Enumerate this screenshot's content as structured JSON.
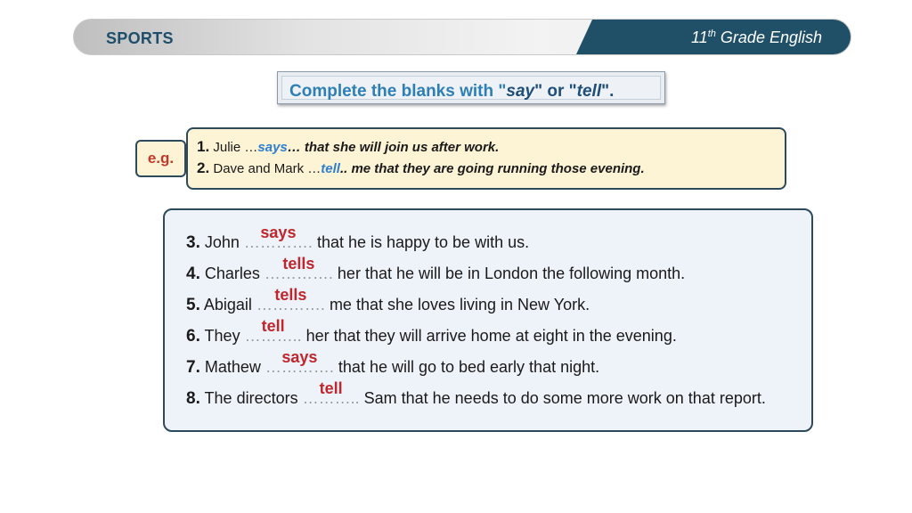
{
  "header": {
    "subject": "SPORTS",
    "grade_prefix": "11",
    "grade_sup": "th",
    "grade_suffix": " Grade English"
  },
  "instruction": {
    "part1": "Complete the blanks with \"",
    "kw1": "say",
    "part2": "\" or \"",
    "kw2": "tell",
    "part3": "\"."
  },
  "example": {
    "label": "e.g.",
    "items": [
      {
        "num": "1.",
        "before": "Julie …",
        "answer": "says",
        "after": "… that she will join us after work."
      },
      {
        "num": "2.",
        "before": "Dave and Mark …",
        "answer": "tell",
        "after": ".. me that they are going running those evening."
      }
    ]
  },
  "exercises": [
    {
      "num": "3.",
      "subject": "John ",
      "dots": "………….",
      "answer": "says",
      "rest": " that he is happy to be with us."
    },
    {
      "num": "4.",
      "subject": "Charles ",
      "dots": "………….",
      "answer": "tells",
      "rest": " her that he will be in London the following month."
    },
    {
      "num": "5.",
      "subject": "Abigail ",
      "dots": "………….",
      "answer": "tells",
      "rest": " me that she loves living in New York."
    },
    {
      "num": "6.",
      "subject": "They ",
      "dots": "………..",
      "answer": "tell",
      "rest": " her that they will arrive home at eight in the evening."
    },
    {
      "num": "7.",
      "subject": "Mathew ",
      "dots": "………….",
      "answer": "says",
      "rest": " that he will go to bed early that night."
    },
    {
      "num": "8.",
      "subject": "The directors ",
      "dots": "………..",
      "answer": "tell",
      "rest": " Sam that he needs to do some more work on that report."
    }
  ]
}
